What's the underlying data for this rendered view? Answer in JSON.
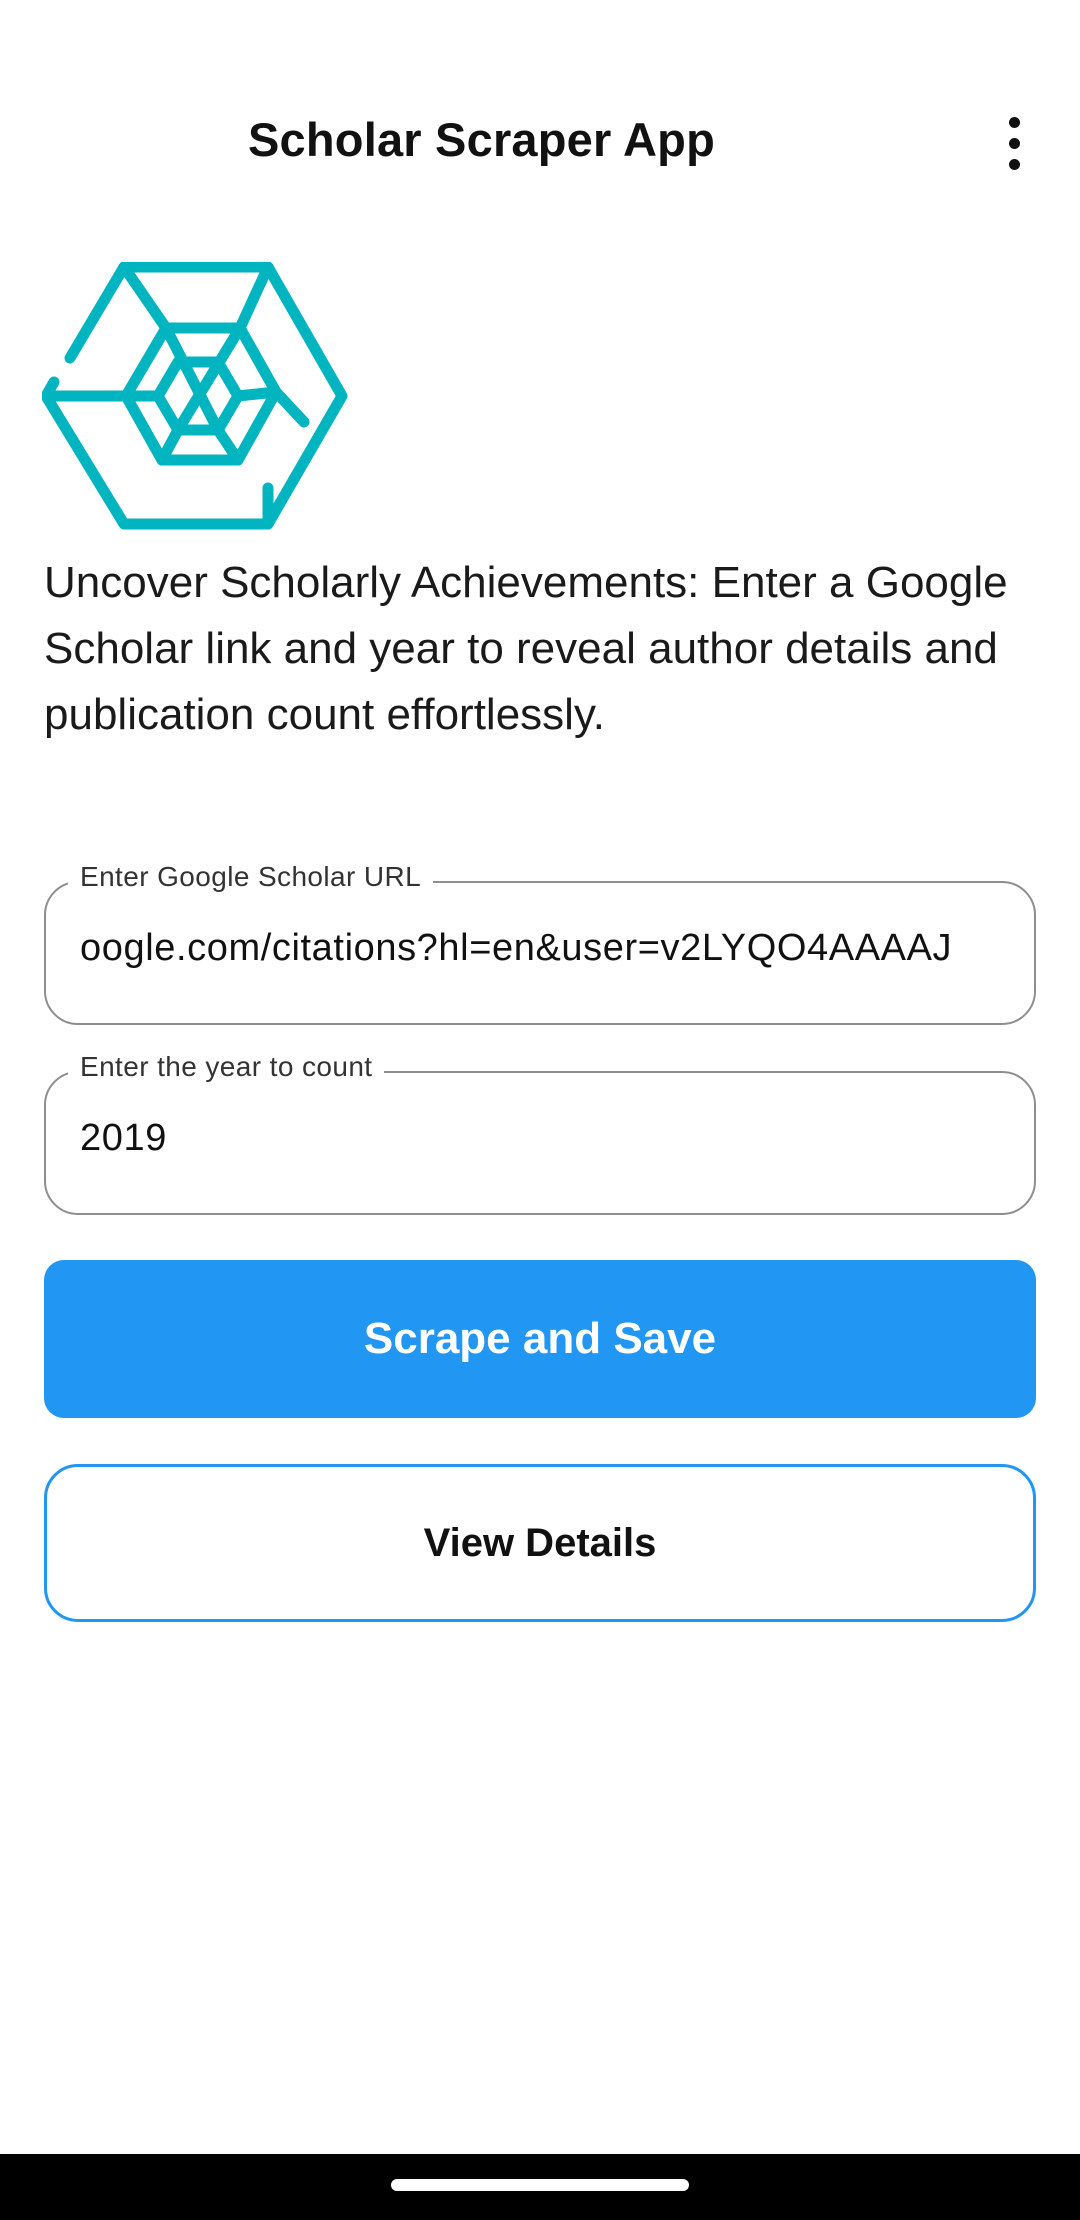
{
  "app_bar": {
    "title": "Scholar Scraper App",
    "menu_icon": "more-vert-icon"
  },
  "logo": {
    "icon": "hexagon-web-logo",
    "color": "#00b4c0"
  },
  "description": "Uncover Scholarly Achievements: Enter a Google Scholar link and year to reveal author details and publication count effortlessly.",
  "form": {
    "url_field": {
      "label": "Enter Google Scholar URL",
      "value": "oogle.com/citations?hl=en&user=v2LYQO4AAAAJ"
    },
    "year_field": {
      "label": "Enter the year to count",
      "value": "2019"
    }
  },
  "buttons": {
    "primary_label": "Scrape and Save",
    "secondary_label": "View Details"
  },
  "colors": {
    "accent": "#2196f3",
    "logo": "#00b4c0",
    "nav_bar": "#000000"
  }
}
